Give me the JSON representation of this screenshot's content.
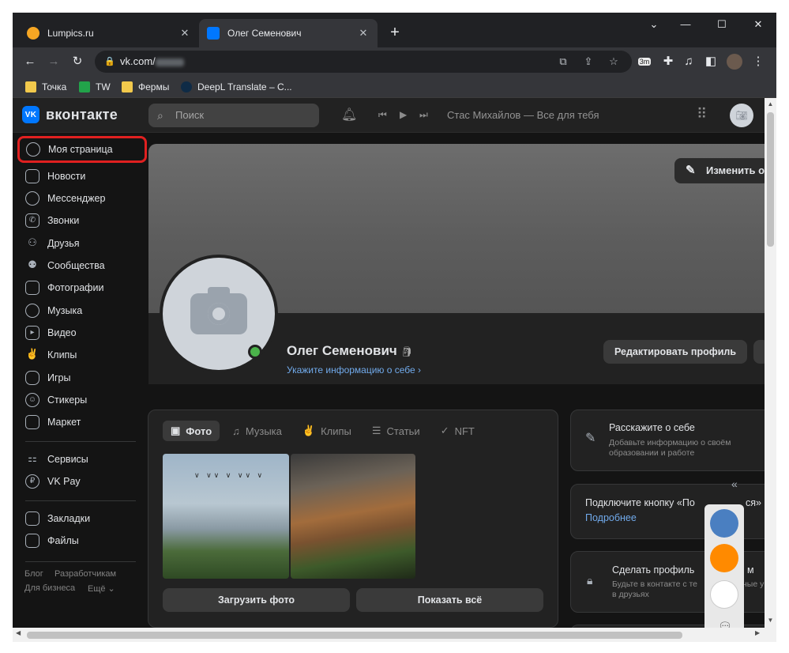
{
  "browser": {
    "tabs": [
      {
        "title": "Lumpics.ru",
        "favicon_color": "#f5a623"
      },
      {
        "title": "Олег Семенович",
        "favicon_color": "#0077ff"
      }
    ],
    "new_tab": "+",
    "url": "vk.com/",
    "bookmarks": [
      {
        "label": "Точка",
        "color": "#f2c94c"
      },
      {
        "label": "TW",
        "color": "#22a34a"
      },
      {
        "label": "Фермы",
        "color": "#f2c94c"
      },
      {
        "label": "DeepL Translate – C...",
        "color": "#0f2b46"
      }
    ],
    "ext_badge": "3m"
  },
  "vk": {
    "logo": "вконтакте",
    "search_placeholder": "Поиск",
    "now_playing": "Стас Михайлов — Все для тебя",
    "nav": [
      {
        "label": "Моя страница",
        "icon": "user-circle-icon"
      },
      {
        "label": "Новости",
        "icon": "news-icon"
      },
      {
        "label": "Мессенджер",
        "icon": "message-icon"
      },
      {
        "label": "Звонки",
        "icon": "phone-icon"
      },
      {
        "label": "Друзья",
        "icon": "friends-icon"
      },
      {
        "label": "Сообщества",
        "icon": "groups-icon"
      },
      {
        "label": "Фотографии",
        "icon": "photo-icon"
      },
      {
        "label": "Музыка",
        "icon": "music-icon"
      },
      {
        "label": "Видео",
        "icon": "video-icon"
      },
      {
        "label": "Клипы",
        "icon": "clips-icon"
      },
      {
        "label": "Игры",
        "icon": "games-icon"
      },
      {
        "label": "Стикеры",
        "icon": "stickers-icon"
      },
      {
        "label": "Маркет",
        "icon": "market-icon"
      },
      {
        "label": "Сервисы",
        "icon": "services-icon"
      },
      {
        "label": "VK Pay",
        "icon": "vkpay-icon"
      },
      {
        "label": "Закладки",
        "icon": "bookmark-icon"
      },
      {
        "label": "Файлы",
        "icon": "file-icon"
      }
    ],
    "footer": {
      "blog": "Блог",
      "developers": "Разработчикам",
      "business": "Для бизнеса",
      "more": "Ещё ⌄"
    },
    "profile": {
      "edit_cover": "Изменить о",
      "name": "Олег Семенович",
      "info_link": "Укажите информацию о себе  ›",
      "edit_profile": "Редактировать профиль"
    },
    "media_tabs": [
      "Фото",
      "Музыка",
      "Клипы",
      "Статьи",
      "NFT"
    ],
    "upload_photo": "Загрузить фото",
    "show_all": "Показать всё",
    "about_card": {
      "title": "Расскажите о себе",
      "subtitle_line1": "Добавьте информацию о своём",
      "subtitle_line2": "образовании и работе"
    },
    "connect_card": {
      "title": "Подключите кнопку «По",
      "title_end": "ся»",
      "link": "Подробнее"
    },
    "private_card": {
      "title": "Сделать профиль",
      "title_end": "м",
      "subtitle_line1": "Будьте в контакте с те",
      "subtitle_line1_end": "ные у",
      "subtitle_line2": "в друзьях"
    }
  }
}
